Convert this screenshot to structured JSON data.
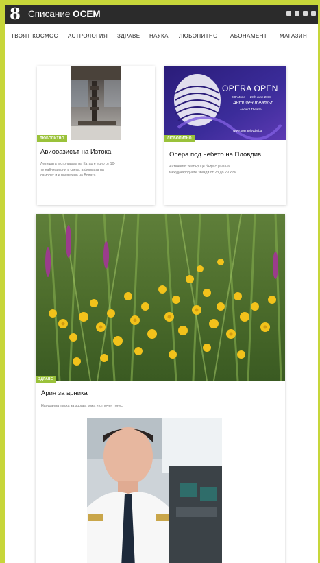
{
  "header": {
    "logo_char": "8",
    "brand_prefix": "Списание",
    "brand_bold": "ОСЕМ",
    "social_icons": [
      "facebook-icon",
      "twitter-icon",
      "instagram-icon",
      "youtube-icon"
    ]
  },
  "nav": {
    "items": [
      "ТВОЯТ КОСМОС",
      "АСТРОЛОГИЯ",
      "ЗДРАВЕ",
      "НАУКА",
      "ЛЮБОПИТНО",
      "АБОНАМЕНТ",
      "МАГАЗИН"
    ]
  },
  "cards": [
    {
      "category": "ЛЮБОПИТНО",
      "title": "Авиооазисът на Изтока",
      "excerpt_lines": [
        "Летищата в столицата на Катар е едно от 10-",
        "те най-модерни в света, а формата на",
        "самолет и е посветено на Водата"
      ]
    },
    {
      "category": "ЛЮБОПИТНО",
      "title": "Опера под небето на Пловдив",
      "excerpt_lines": [
        "Античният театър ще бъде сцена на",
        "международните звезди от 23 до 29 юли"
      ],
      "poster": {
        "headline": "OPERA OPEN",
        "dates": "23th June — 29th June 2018",
        "venue_bg": "Античен театър",
        "venue_en": "Ancient Theatre",
        "url": "www.operaplovdiv.bg"
      }
    },
    {
      "category": "ЗДРАВЕ",
      "title": "Ария за арника",
      "excerpt_lines": [
        "Натурална грижа за здрава кожа и отпочен тонус"
      ]
    }
  ],
  "colors": {
    "accent": "#c7d63a",
    "badge": "#9ac23a",
    "topbar": "#2b2b2b"
  }
}
